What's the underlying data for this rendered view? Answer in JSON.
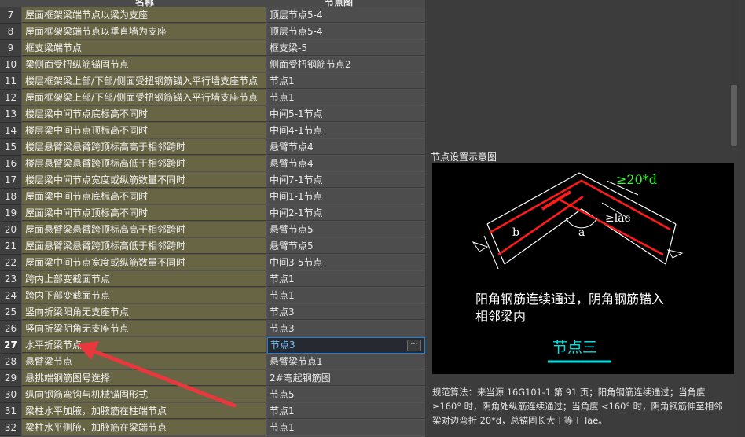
{
  "grid": {
    "columns": [
      "名称",
      "节点图"
    ],
    "selected_row": "27",
    "rows": [
      {
        "n": "7",
        "name": "屋面框架梁端节点以梁为支座",
        "value": "顶层节点5-4"
      },
      {
        "n": "8",
        "name": "屋面框架梁端节点以垂直墙为支座",
        "value": "顶层节点5-4"
      },
      {
        "n": "9",
        "name": "框支梁端节点",
        "value": "框支梁-5"
      },
      {
        "n": "10",
        "name": "梁侧面受扭纵筋锚固节点",
        "value": "侧面受扭钢筋节点2"
      },
      {
        "n": "11",
        "name": "楼层框架梁上部/下部/侧面受扭钢筋锚入平行墙支座节点",
        "value": "节点1"
      },
      {
        "n": "12",
        "name": "屋面框架梁上部/下部/侧面受扭钢筋锚入平行墙支座节点",
        "value": "节点1"
      },
      {
        "n": "13",
        "name": "楼层梁中间节点底标高不同时",
        "value": "中间5-1节点"
      },
      {
        "n": "14",
        "name": "楼层梁中间节点顶标高不同时",
        "value": "中间4-1节点"
      },
      {
        "n": "15",
        "name": "楼层悬臂梁悬臂跨顶标高高于相邻跨时",
        "value": "悬臂节点4"
      },
      {
        "n": "16",
        "name": "楼层悬臂梁悬臂跨顶标高低于相邻跨时",
        "value": "悬臂节点4"
      },
      {
        "n": "17",
        "name": "楼层梁中间节点宽度或纵筋数量不同时",
        "value": "中间7-1节点"
      },
      {
        "n": "18",
        "name": "屋面梁中间节点底标高不同时",
        "value": "中间1-1节点"
      },
      {
        "n": "19",
        "name": "屋面梁中间节点顶标高不同时",
        "value": "中间2-1节点"
      },
      {
        "n": "20",
        "name": "屋面悬臂梁悬臂跨顶标高高于相邻跨时",
        "value": "悬臂节点5"
      },
      {
        "n": "21",
        "name": "屋面悬臂梁悬臂跨顶标高低于相邻跨时",
        "value": "悬臂节点5"
      },
      {
        "n": "22",
        "name": "屋面梁中间节点宽度或纵筋数量不同时",
        "value": "中间3-5节点"
      },
      {
        "n": "23",
        "name": "跨内上部变截面节点",
        "value": "节点1"
      },
      {
        "n": "24",
        "name": "跨内下部变截面节点",
        "value": "节点1"
      },
      {
        "n": "25",
        "name": "竖向折梁阳角无支座节点",
        "value": "节点3"
      },
      {
        "n": "26",
        "name": "竖向折梁阴角无支座节点",
        "value": "节点3"
      },
      {
        "n": "27",
        "name": "水平折梁节点",
        "value": "节点3"
      },
      {
        "n": "28",
        "name": "悬臂梁节点",
        "value": "悬臂梁节点1"
      },
      {
        "n": "29",
        "name": "悬挑端钢筋图号选择",
        "value": "2#弯起钢筋图"
      },
      {
        "n": "30",
        "name": "纵向钢筋弯钩与机械锚固形式",
        "value": "节点5"
      },
      {
        "n": "31",
        "name": "梁柱水平加腋，加腋筋在柱端节点",
        "value": "节点1"
      },
      {
        "n": "32",
        "name": "梁柱水平侧腋，加腋筋在梁端节点",
        "value": "节点1"
      }
    ]
  },
  "panel": {
    "title": "节点设置示意图",
    "diagram": {
      "dim_top": "≥20*d",
      "dim_lae": "≥lae",
      "label_b": "b",
      "label_a": "a",
      "caption_line1": "阳角钢筋连续通过，阴角钢筋锚入",
      "caption_line2": "相邻梁内",
      "node_name": "节点三"
    },
    "description": "规范算法：来当源 16G101-1 第 91 页；阳角钢筋连续通过；当角度\n≥160° 时，阴角处纵筋连续通过；当角度 <160° 时，阴角钢筋伸至相邻\n梁对边弯折 20*d，总锚固长大于等于 lae。"
  },
  "colors": {
    "name_cell": "#686545",
    "value_cell": "#4d4d4d",
    "selection_border": "#1f7fd8",
    "rebar": "#ff1a1a",
    "dim_green": "#33ff33",
    "node_cyan": "#00e0e0",
    "annotation_arrow": "#e8383d"
  }
}
